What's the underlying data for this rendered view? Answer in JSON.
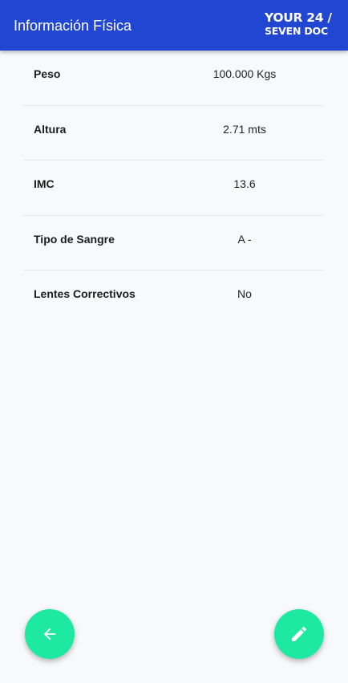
{
  "header": {
    "title": "Información Física",
    "logo_line1": "YOUR 24 /",
    "logo_line2": "SEVEN DOC"
  },
  "info": [
    {
      "label": "Peso",
      "value": "100.000 Kgs"
    },
    {
      "label": "Altura",
      "value": "2.71 mts"
    },
    {
      "label": "IMC",
      "value": "13.6"
    },
    {
      "label": "Tipo de Sangre",
      "value": "A -"
    },
    {
      "label": "Lentes Correctivos",
      "value": "No"
    }
  ],
  "actions": {
    "back_icon": "arrow-left-icon",
    "edit_icon": "pencil-icon"
  },
  "colors": {
    "appbar": "#2146d2",
    "fab": "#1de9a3",
    "background": "#f8f9fa"
  }
}
